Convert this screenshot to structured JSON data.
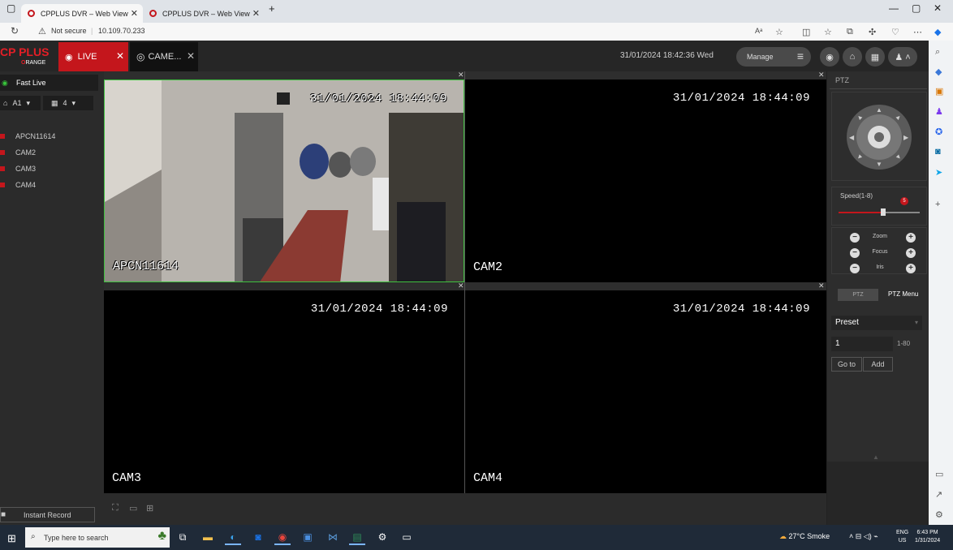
{
  "browser": {
    "tabs": [
      {
        "title": "CPPLUS DVR – Web View",
        "active": true
      },
      {
        "title": "CPPLUS DVR – Web View",
        "active": false
      }
    ],
    "new_tab": "+",
    "security_label": "Not secure",
    "url": "10.109.70.233"
  },
  "app": {
    "logo_top": "CP PLUS",
    "logo_bottom": "RANGE",
    "logo_badge": "O",
    "live_tab": "LIVE",
    "cam_tab": "CAME...",
    "datetime": "31/01/2024 18:42:36 Wed",
    "manage_label": "Manage"
  },
  "left": {
    "fast_live": "Fast Live",
    "stream": "A1",
    "layout_count": "4",
    "cameras": [
      "APCN11614",
      "CAM2",
      "CAM3",
      "CAM4"
    ],
    "instant_record": "Instant Record"
  },
  "video": {
    "cells": [
      {
        "name": "APCN11614",
        "timestamp": "31/01/2024 18:44:09"
      },
      {
        "name": "CAM2",
        "timestamp": "31/01/2024 18:44:09"
      },
      {
        "name": "CAM3",
        "timestamp": "31/01/2024 18:44:09"
      },
      {
        "name": "CAM4",
        "timestamp": "31/01/2024 18:44:09"
      }
    ]
  },
  "ptz": {
    "title": "PTZ",
    "speed_label": "Speed(1-8)",
    "speed_value": "5",
    "speed_fraction": 0.55,
    "zoom": "Zoom",
    "focus": "Focus",
    "iris": "Iris",
    "tab_ptz": "PTZ",
    "tab_menu": "PTZ Menu",
    "preset_label": "Preset",
    "preset_value": "1",
    "preset_range": "1-80",
    "goto": "Go to",
    "add": "Add"
  },
  "taskbar": {
    "search_placeholder": "Type here to search",
    "weather": "27°C  Smoke",
    "lang_top": "ENG",
    "lang_bottom": "US",
    "time": "6:43 PM",
    "date": "1/31/2024"
  },
  "colors": {
    "brand_red": "#c4161c",
    "live_green": "#38c43b"
  }
}
